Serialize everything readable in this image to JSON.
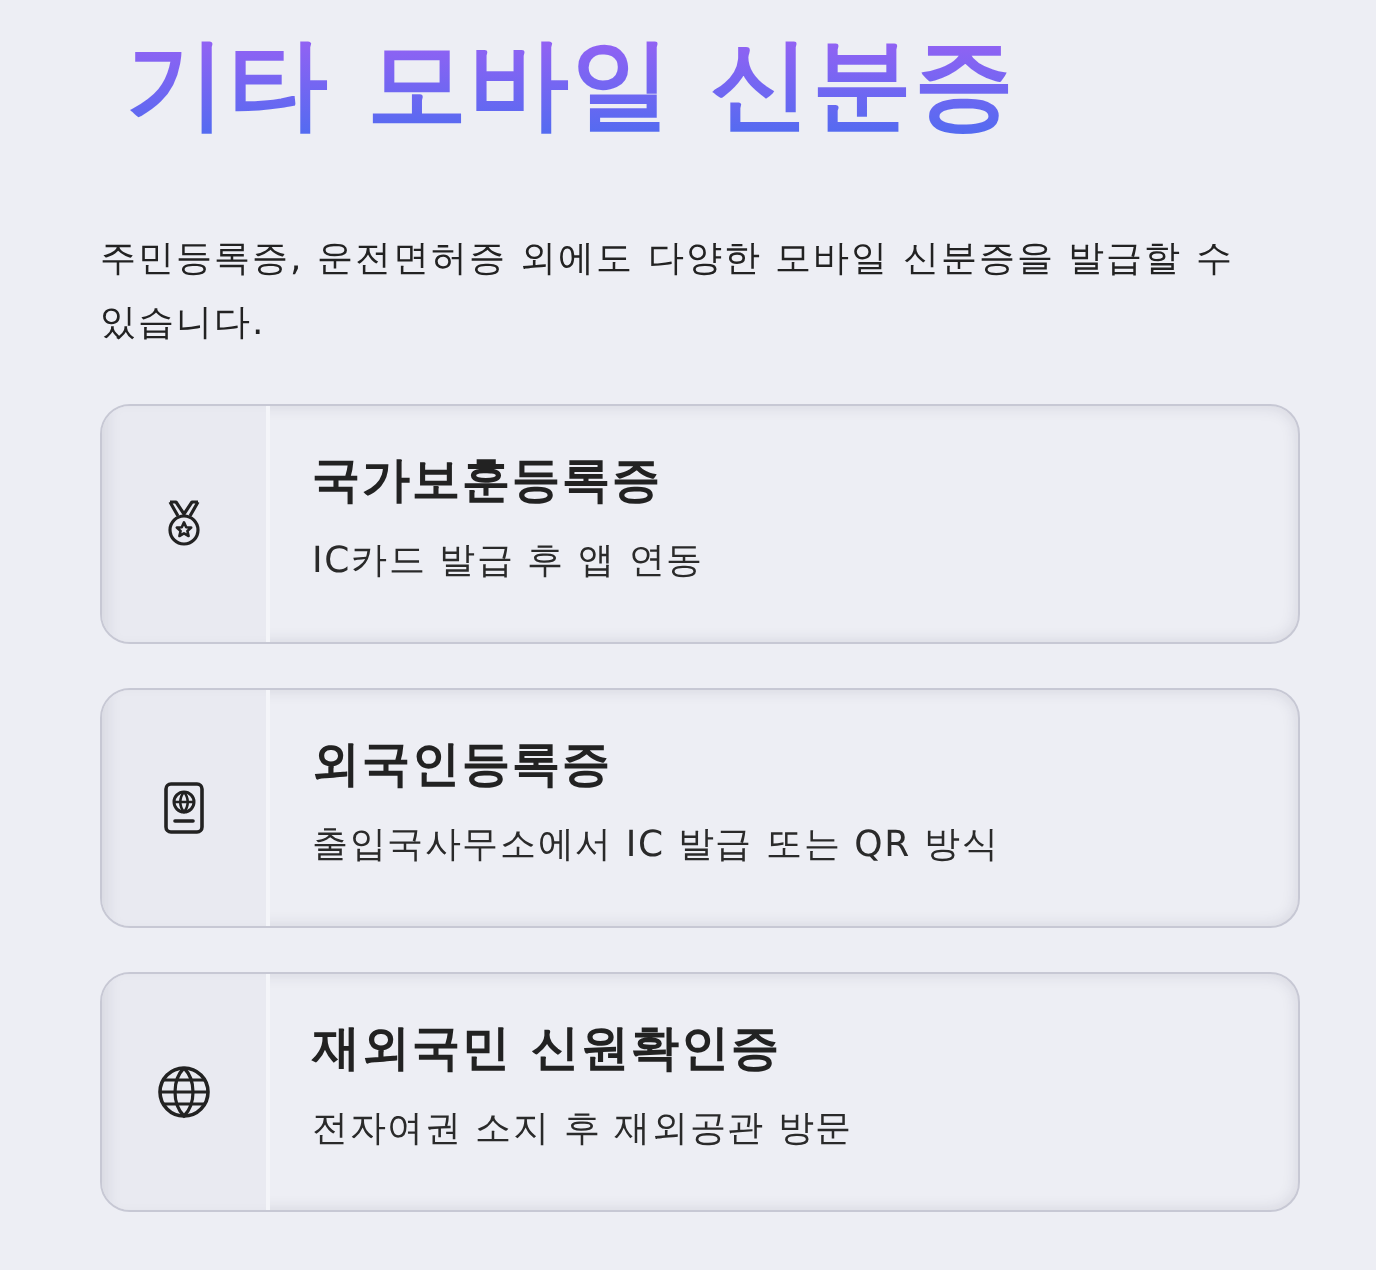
{
  "title": "기타 모바일 신분증",
  "description": "주민등록증, 운전면허증 외에도 다양한 모바일 신분증을 발급할 수 있습니다.",
  "cards": [
    {
      "title": "국가보훈등록증",
      "subtitle": "IC카드 발급 후 앱 연동"
    },
    {
      "title": "외국인등록증",
      "subtitle": "출입국사무소에서 IC 발급 또는 QR 방식"
    },
    {
      "title": "재외국민 신원확인증",
      "subtitle": "전자여권 소지 후 재외공관 방문"
    }
  ]
}
